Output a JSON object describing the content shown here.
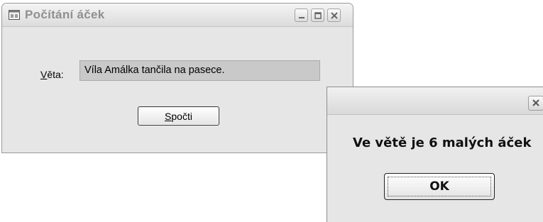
{
  "main_window": {
    "title": "Počítání áček",
    "sentence_label_mnemonic": "V",
    "sentence_label_rest": "ěta:",
    "sentence_value": "Víla Amálka tančila na pasece.",
    "count_button_mnemonic": "S",
    "count_button_rest": "počti",
    "controls": [
      "minimize-icon",
      "maximize-icon",
      "close-icon"
    ]
  },
  "message_box": {
    "message": "Ve větě je 6 malých áček",
    "ok_label": "OK"
  },
  "colors": {
    "window_bg": "#e6e6e6",
    "title_text": "#8f8f8f",
    "input_bg": "#c9c9c9"
  }
}
